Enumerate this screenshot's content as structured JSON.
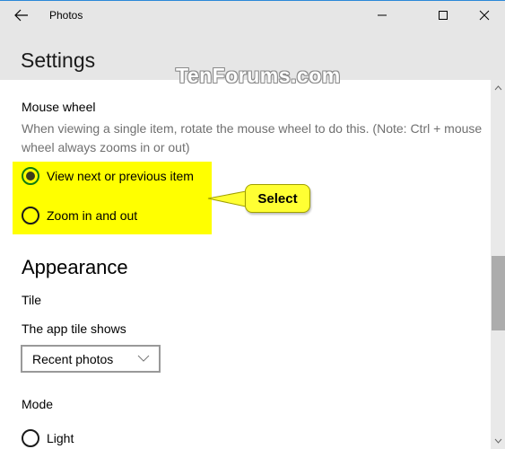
{
  "window": {
    "app_title": "Photos",
    "back_icon": "back-arrow-icon",
    "controls": [
      "minimize",
      "maximize",
      "close"
    ],
    "accent_color": "#2b88d8"
  },
  "page": {
    "title": "Settings"
  },
  "watermark": "TenForums.com",
  "mouse_wheel": {
    "heading": "Mouse wheel",
    "description": "When viewing a single item, rotate the mouse wheel to do this. (Note: Ctrl + mouse wheel always zooms in or out)",
    "options": [
      {
        "label": "View next or previous item",
        "selected": true
      },
      {
        "label": "Zoom in and out",
        "selected": false
      }
    ],
    "highlight_color": "#ffff00"
  },
  "callout": {
    "text": "Select"
  },
  "appearance": {
    "heading": "Appearance",
    "tile": {
      "heading": "Tile",
      "label": "The app tile shows",
      "selected_value": "Recent photos"
    },
    "mode": {
      "heading": "Mode",
      "options": [
        {
          "label": "Light",
          "selected": false
        }
      ]
    }
  },
  "scrollbar": {
    "position_fraction": 0.5
  }
}
